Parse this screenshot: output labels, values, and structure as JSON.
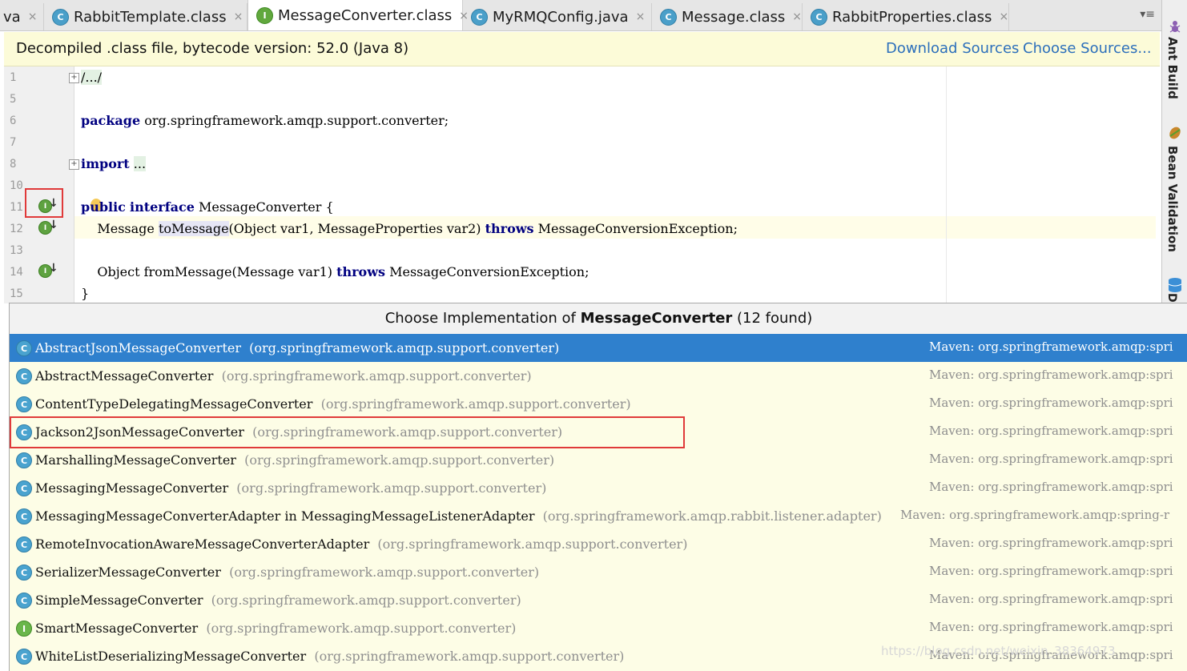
{
  "tabs": [
    {
      "label": "va",
      "icon": "",
      "close": "×"
    },
    {
      "label": "RabbitTemplate.class",
      "icon": "C",
      "close": "×"
    },
    {
      "label": "MessageConverter.class",
      "icon": "I",
      "close": "×"
    },
    {
      "label": "MyRMQConfig.java",
      "icon": "C",
      "close": "×"
    },
    {
      "label": "Message.class",
      "icon": "C",
      "close": "×"
    },
    {
      "label": "RabbitProperties.class",
      "icon": "C",
      "close": "×"
    }
  ],
  "tab_overflow": "▾≡",
  "right_strip": {
    "ant_build": "Ant Build",
    "bean_validation": "Bean Validation",
    "database": "D"
  },
  "banner": {
    "text": "Decompiled .class file, bytecode version: 52.0 (Java 8)",
    "download_sources": "Download Sources",
    "choose_sources": "Choose Sources..."
  },
  "editor": {
    "line_numbers": [
      "1",
      "5",
      "6",
      "7",
      "8",
      "10",
      "11",
      "12",
      "13",
      "14",
      "15"
    ],
    "line1": "/.../",
    "line6_kw": "package",
    "line6_rest": " org.springframework.amqp.support.converter;",
    "line8_kw": "import",
    "line8_fold": "...",
    "line11_kw1": "public",
    "line11_kw2": "interface",
    "line11_rest": " MessageConverter {",
    "line12_a": "    Message ",
    "line12_method": "toMessage",
    "line12_b": "(Object var1, MessageProperties var2) ",
    "line12_kw": "throws",
    "line12_c": " MessageConversionException;",
    "line14_a": "    Object fromMessage(Message var1) ",
    "line14_kw": "throws",
    "line14_c": " MessageConversionException;",
    "line15": "}",
    "gutter_icon": "I"
  },
  "popup": {
    "title_prefix": "Choose Implementation of ",
    "title_bold": "MessageConverter",
    "title_suffix": " (12 found)",
    "items": [
      {
        "icon": "C",
        "name": "AbstractJsonMessageConverter",
        "pkg": "(org.springframework.amqp.support.converter)",
        "maven": "Maven: org.springframework.amqp:spri"
      },
      {
        "icon": "C",
        "name": "AbstractMessageConverter",
        "pkg": "(org.springframework.amqp.support.converter)",
        "maven": "Maven: org.springframework.amqp:spri"
      },
      {
        "icon": "C",
        "name": "ContentTypeDelegatingMessageConverter",
        "pkg": "(org.springframework.amqp.support.converter)",
        "maven": "Maven: org.springframework.amqp:spri"
      },
      {
        "icon": "C",
        "name": "Jackson2JsonMessageConverter",
        "pkg": "(org.springframework.amqp.support.converter)",
        "maven": "Maven: org.springframework.amqp:spri"
      },
      {
        "icon": "C",
        "name": "MarshallingMessageConverter",
        "pkg": "(org.springframework.amqp.support.converter)",
        "maven": "Maven: org.springframework.amqp:spri"
      },
      {
        "icon": "C",
        "name": "MessagingMessageConverter",
        "pkg": "(org.springframework.amqp.support.converter)",
        "maven": "Maven: org.springframework.amqp:spri"
      },
      {
        "icon": "C",
        "name": "MessagingMessageConverterAdapter in MessagingMessageListenerAdapter",
        "pkg": "(org.springframework.amqp.rabbit.listener.adapter)",
        "maven": "Maven: org.springframework.amqp:spring-r"
      },
      {
        "icon": "C",
        "name": "RemoteInvocationAwareMessageConverterAdapter",
        "pkg": "(org.springframework.amqp.support.converter)",
        "maven": "Maven: org.springframework.amqp:spri"
      },
      {
        "icon": "C",
        "name": "SerializerMessageConverter",
        "pkg": "(org.springframework.amqp.support.converter)",
        "maven": "Maven: org.springframework.amqp:spri"
      },
      {
        "icon": "C",
        "name": "SimpleMessageConverter",
        "pkg": "(org.springframework.amqp.support.converter)",
        "maven": "Maven: org.springframework.amqp:spri"
      },
      {
        "icon": "I",
        "name": "SmartMessageConverter",
        "pkg": "(org.springframework.amqp.support.converter)",
        "maven": "Maven: org.springframework.amqp:spri"
      },
      {
        "icon": "C",
        "name": "WhiteListDeserializingMessageConverter",
        "pkg": "(org.springframework.amqp.support.converter)",
        "maven": "Maven: org.springframework.amqp:spri"
      }
    ],
    "watermark": "https://blog.csdn.net/weixin_38364973"
  }
}
